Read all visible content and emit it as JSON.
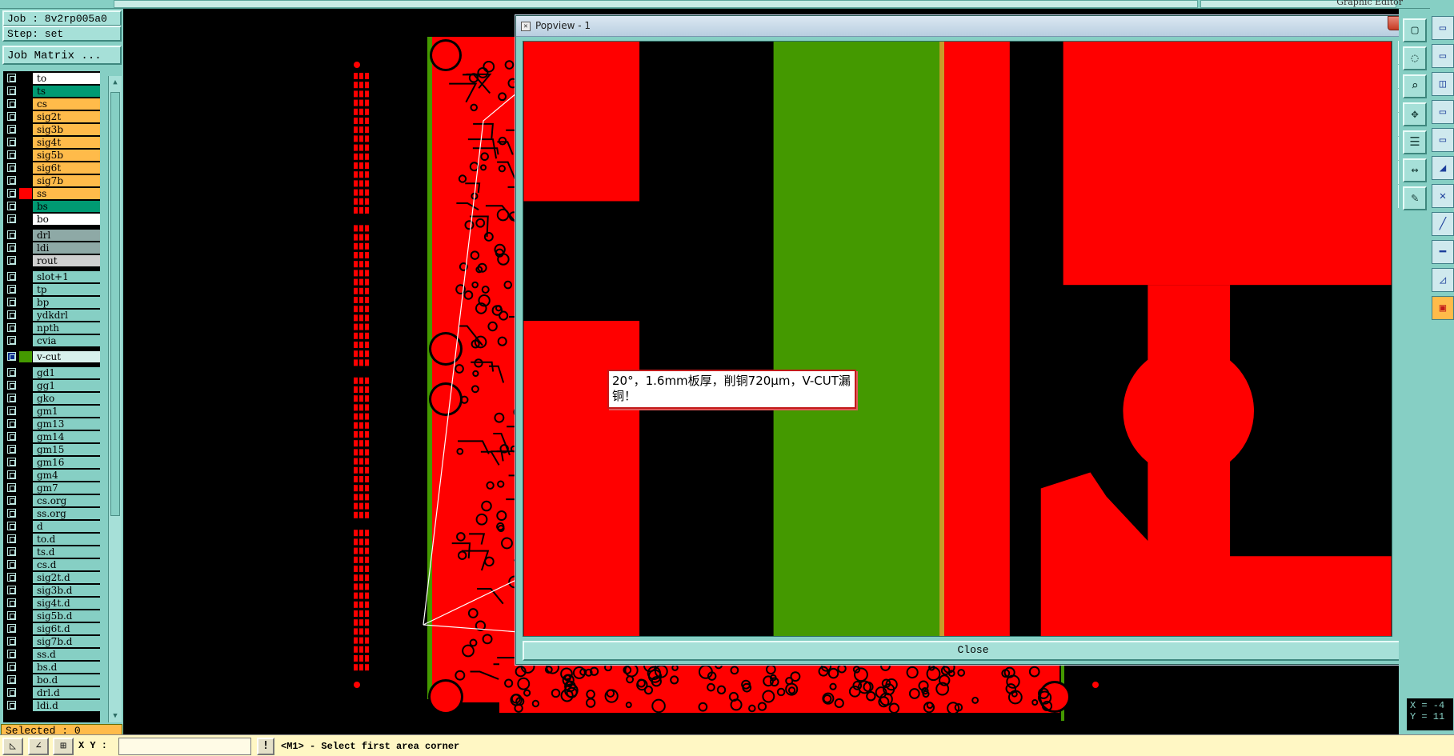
{
  "app": {
    "title": "Graphic Editor",
    "colors": {
      "panel": "#86cfc4",
      "board_copper": "#ff0000",
      "vcut_layer": "#449900",
      "selected_bar": "#ffbb4a"
    }
  },
  "job": {
    "job_label": "Job : 8v2rp005a0",
    "step_label": "Step: set",
    "matrix_button": "Job Matrix ..."
  },
  "layers": [
    {
      "name": "to",
      "color": "#ffffff",
      "swatch": "#000000"
    },
    {
      "name": "ts",
      "color": "#009a73",
      "swatch": "#000000"
    },
    {
      "name": "cs",
      "color": "#ffbb4a",
      "swatch": "#000000"
    },
    {
      "name": "sig2t",
      "color": "#ffbb4a",
      "swatch": "#000000"
    },
    {
      "name": "sig3b",
      "color": "#ffbb4a",
      "swatch": "#000000"
    },
    {
      "name": "sig4t",
      "color": "#ffbb4a",
      "swatch": "#000000"
    },
    {
      "name": "sig5b",
      "color": "#ffbb4a",
      "swatch": "#000000"
    },
    {
      "name": "sig6t",
      "color": "#ffbb4a",
      "swatch": "#000000"
    },
    {
      "name": "sig7b",
      "color": "#ffbb4a",
      "swatch": "#000000"
    },
    {
      "name": "ss",
      "color": "#ffbb4a",
      "swatch": "#ff0000"
    },
    {
      "name": "bs",
      "color": "#009a73",
      "swatch": "#000000"
    },
    {
      "name": "bo",
      "color": "#ffffff",
      "swatch": "#000000"
    },
    {
      "name": "drl",
      "color": "#8ea9a6",
      "swatch": "#000000",
      "gap": true
    },
    {
      "name": "ldi",
      "color": "#8ea9a6",
      "swatch": "#000000"
    },
    {
      "name": "rout",
      "color": "#cfcfcf",
      "swatch": "#000000"
    },
    {
      "name": "slot+1",
      "color": "#86cfc4",
      "swatch": "#000000",
      "gap": true
    },
    {
      "name": "tp",
      "color": "#86cfc4",
      "swatch": "#000000"
    },
    {
      "name": "bp",
      "color": "#86cfc4",
      "swatch": "#000000"
    },
    {
      "name": "ydkdrl",
      "color": "#86cfc4",
      "swatch": "#000000"
    },
    {
      "name": "npth",
      "color": "#86cfc4",
      "swatch": "#000000"
    },
    {
      "name": "cvia",
      "color": "#86cfc4",
      "swatch": "#000000"
    },
    {
      "name": "v-cut",
      "color": "#d8f0ec",
      "swatch": "#449900",
      "gap": true,
      "active": true
    },
    {
      "name": "gd1",
      "color": "#86cfc4",
      "swatch": "#000000",
      "gap": true
    },
    {
      "name": "gg1",
      "color": "#86cfc4",
      "swatch": "#000000"
    },
    {
      "name": "gko",
      "color": "#86cfc4",
      "swatch": "#000000"
    },
    {
      "name": "gm1",
      "color": "#86cfc4",
      "swatch": "#000000"
    },
    {
      "name": "gm13",
      "color": "#86cfc4",
      "swatch": "#000000"
    },
    {
      "name": "gm14",
      "color": "#86cfc4",
      "swatch": "#000000"
    },
    {
      "name": "gm15",
      "color": "#86cfc4",
      "swatch": "#000000"
    },
    {
      "name": "gm16",
      "color": "#86cfc4",
      "swatch": "#000000"
    },
    {
      "name": "gm4",
      "color": "#86cfc4",
      "swatch": "#000000"
    },
    {
      "name": "gm7",
      "color": "#86cfc4",
      "swatch": "#000000"
    },
    {
      "name": "cs.org",
      "color": "#86cfc4",
      "swatch": "#000000"
    },
    {
      "name": "ss.org",
      "color": "#86cfc4",
      "swatch": "#000000"
    },
    {
      "name": "d",
      "color": "#86cfc4",
      "swatch": "#000000"
    },
    {
      "name": "to.d",
      "color": "#86cfc4",
      "swatch": "#000000"
    },
    {
      "name": "ts.d",
      "color": "#86cfc4",
      "swatch": "#000000"
    },
    {
      "name": "cs.d",
      "color": "#86cfc4",
      "swatch": "#000000"
    },
    {
      "name": "sig2t.d",
      "color": "#86cfc4",
      "swatch": "#000000"
    },
    {
      "name": "sig3b.d",
      "color": "#86cfc4",
      "swatch": "#000000"
    },
    {
      "name": "sig4t.d",
      "color": "#86cfc4",
      "swatch": "#000000"
    },
    {
      "name": "sig5b.d",
      "color": "#86cfc4",
      "swatch": "#000000"
    },
    {
      "name": "sig6t.d",
      "color": "#86cfc4",
      "swatch": "#000000"
    },
    {
      "name": "sig7b.d",
      "color": "#86cfc4",
      "swatch": "#000000"
    },
    {
      "name": "ss.d",
      "color": "#86cfc4",
      "swatch": "#000000"
    },
    {
      "name": "bs.d",
      "color": "#86cfc4",
      "swatch": "#000000"
    },
    {
      "name": "bo.d",
      "color": "#86cfc4",
      "swatch": "#000000"
    },
    {
      "name": "drl.d",
      "color": "#86cfc4",
      "swatch": "#000000"
    },
    {
      "name": "ldi.d",
      "color": "#86cfc4",
      "swatch": "#000000"
    }
  ],
  "status": {
    "selected": "Selected : 0",
    "xy_label": "X Y :",
    "xy_value": "",
    "prompt": "<M1> - Select first area corner",
    "coord_x": "X = -4",
    "coord_y": "Y = 11"
  },
  "popview": {
    "title": "Popview - 1",
    "close_label": "Close",
    "annotation": "20°，1.6mm板厚，削铜720μm，V-CUT漏铜！"
  },
  "icons": {
    "popview_tools": [
      "zoom-fit-icon",
      "zoom-in-icon",
      "zoom-out-icon",
      "pan-left-icon",
      "pan-right-icon",
      "zoom-extents-icon",
      "zoom-area-icon"
    ]
  }
}
